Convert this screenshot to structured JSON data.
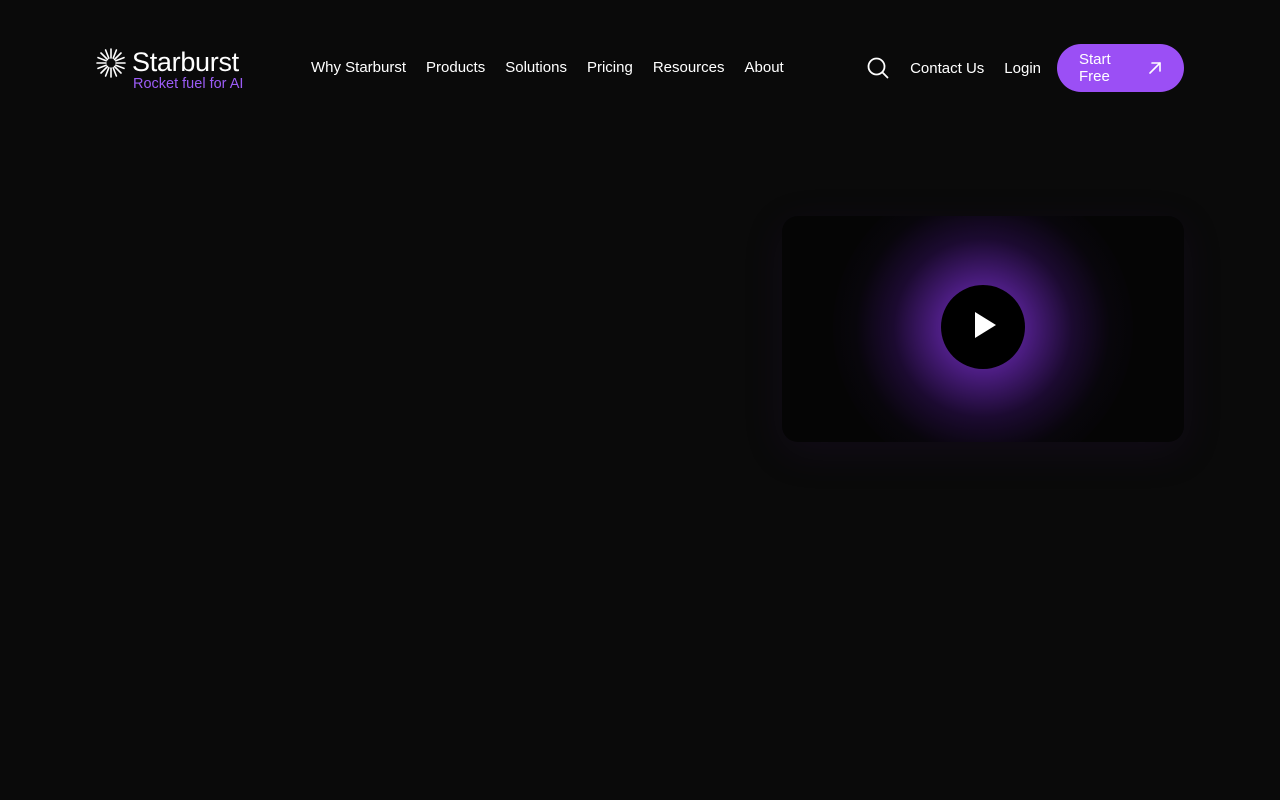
{
  "brand": {
    "name": "Starburst",
    "tagline": "Rocket fuel for AI",
    "logo_icon": "starburst-icon",
    "tagline_color": "#9b5cf6"
  },
  "nav": {
    "items": [
      {
        "label": "Why Starburst"
      },
      {
        "label": "Products"
      },
      {
        "label": "Solutions"
      },
      {
        "label": "Pricing"
      },
      {
        "label": "Resources"
      },
      {
        "label": "About"
      }
    ]
  },
  "header_actions": {
    "search_icon": "search-icon",
    "contact_label": "Contact Us",
    "login_label": "Login",
    "start_label": "Start Free",
    "start_icon": "arrow-up-right-icon",
    "accent_color": "#9b4ff5"
  },
  "video": {
    "play_icon": "play-icon"
  },
  "colors": {
    "background": "#0a0a0a",
    "glow": "#8c3ce6"
  }
}
